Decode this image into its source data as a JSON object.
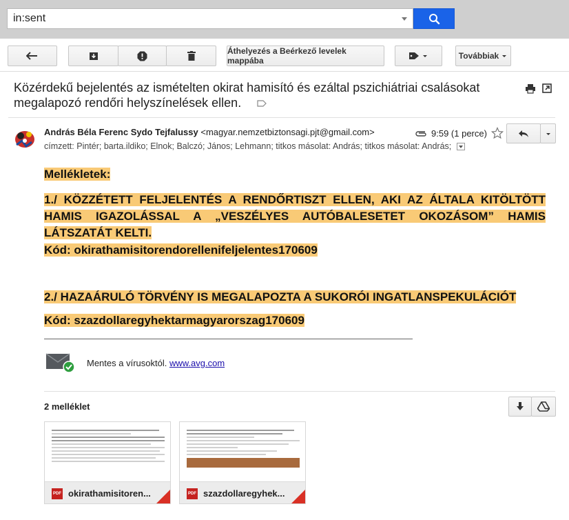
{
  "search": {
    "value": "in:sent"
  },
  "toolbar": {
    "move_inbox_label": "Áthelyezés a Beérkező levelek mappába",
    "more_label": "Továbbiak"
  },
  "message": {
    "subject": "Közérdekű bejelentés az ismételten okirat hamisító és ezáltal pszichiátriai csalásokat megalapozó rendőri helyszínelések ellen.",
    "sender_name": "András Béla Ferenc Sydo Tejfalussy",
    "sender_email": "<magyar.nemzetbiztonsagi.pjt@gmail.com>",
    "time": "9:59 (1 perce)",
    "recipients": "címzett: Pintér; barta.ildiko; Elnok; Balczó; János; Lehmann; titkos másolat: András; titkos másolat: András;"
  },
  "body": {
    "attachments_heading": "Mellékletek:",
    "item1": "1./ KÖZZÉTETT FELJELENTÉS A RENDŐRTISZT ELLEN, AKI AZ ÁLTALA KITÖLTÖTT HAMIS IGAZOLÁSSAL A „VESZÉLYES AUTÓBALESETET OKOZÁSOM” HAMIS LÁTSZATÁT KELTI.",
    "code1": "Kód: okirathamisitorendorellenifeljelentes170609",
    "item2": "2./ HAZAÁRULÓ TÖRVÉNY IS MEGALAPOZTA A SUKORÓI INGATLANSPEKULÁCIÓT",
    "code2": "Kód: szazdollaregyhektarmagyarorszag170609"
  },
  "avg": {
    "text": "Mentes a vírusoktól.",
    "link": "www.avg.com"
  },
  "attachments": {
    "count_label": "2 melléklet",
    "files": [
      {
        "name": "okirathamisitoren...",
        "type_badge": "PDF"
      },
      {
        "name": "szazdollaregyhek...",
        "type_badge": "PDF"
      }
    ]
  },
  "colors": {
    "highlight": "#f9ca76",
    "search_button": "#1a63e8",
    "pdf_red": "#c5221f"
  },
  "icons": [
    "search-icon",
    "back-arrow-icon",
    "archive-icon",
    "spam-icon",
    "trash-icon",
    "label-tag-icon",
    "print-icon",
    "popout-icon",
    "paperclip-icon",
    "star-icon",
    "reply-icon",
    "download-icon",
    "drive-icon",
    "avg-envelope-icon",
    "pdf-icon"
  ]
}
